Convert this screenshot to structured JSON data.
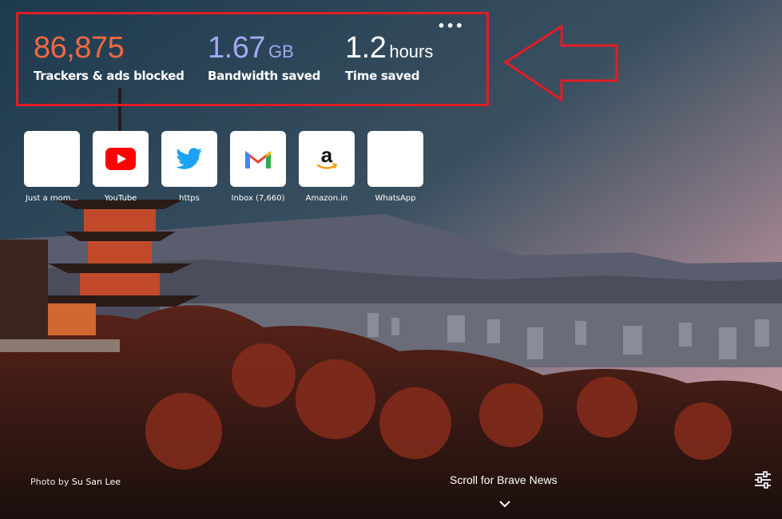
{
  "stats": {
    "trackers": {
      "value": "86,875",
      "label": "Trackers & ads blocked",
      "color": "#f0693f"
    },
    "bandwidth": {
      "value": "1.67",
      "unit": "GB",
      "label": "Bandwidth saved",
      "color": "#a3a8f4"
    },
    "time": {
      "value": "1.2",
      "unit": "hours",
      "label": "Time saved",
      "color": "#ffffff"
    },
    "more_label": "•••"
  },
  "top_sites": [
    {
      "name": "Just a mom...",
      "icon": "blank-icon"
    },
    {
      "name": "YouTube",
      "icon": "youtube-icon"
    },
    {
      "name": "https",
      "icon": "twitter-icon"
    },
    {
      "name": "Inbox (7,660)",
      "icon": "gmail-icon"
    },
    {
      "name": "Amazon.in",
      "icon": "amazon-icon"
    },
    {
      "name": "WhatsApp",
      "icon": "blank-icon"
    }
  ],
  "photo_credit": {
    "prefix": "Photo by",
    "author": "Su San Lee"
  },
  "scroll_news": "Scroll for Brave News",
  "annotation_color": "#e11d24"
}
